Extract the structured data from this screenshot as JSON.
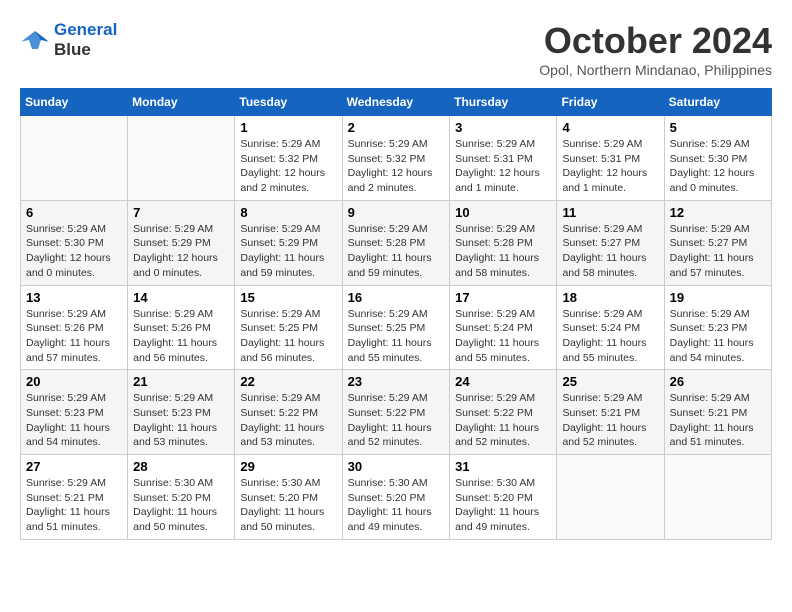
{
  "header": {
    "logo_line1": "General",
    "logo_line2": "Blue",
    "month": "October 2024",
    "location": "Opol, Northern Mindanao, Philippines"
  },
  "weekdays": [
    "Sunday",
    "Monday",
    "Tuesday",
    "Wednesday",
    "Thursday",
    "Friday",
    "Saturday"
  ],
  "weeks": [
    [
      {
        "day": "",
        "info": ""
      },
      {
        "day": "",
        "info": ""
      },
      {
        "day": "1",
        "info": "Sunrise: 5:29 AM\nSunset: 5:32 PM\nDaylight: 12 hours\nand 2 minutes."
      },
      {
        "day": "2",
        "info": "Sunrise: 5:29 AM\nSunset: 5:32 PM\nDaylight: 12 hours\nand 2 minutes."
      },
      {
        "day": "3",
        "info": "Sunrise: 5:29 AM\nSunset: 5:31 PM\nDaylight: 12 hours\nand 1 minute."
      },
      {
        "day": "4",
        "info": "Sunrise: 5:29 AM\nSunset: 5:31 PM\nDaylight: 12 hours\nand 1 minute."
      },
      {
        "day": "5",
        "info": "Sunrise: 5:29 AM\nSunset: 5:30 PM\nDaylight: 12 hours\nand 0 minutes."
      }
    ],
    [
      {
        "day": "6",
        "info": "Sunrise: 5:29 AM\nSunset: 5:30 PM\nDaylight: 12 hours\nand 0 minutes."
      },
      {
        "day": "7",
        "info": "Sunrise: 5:29 AM\nSunset: 5:29 PM\nDaylight: 12 hours\nand 0 minutes."
      },
      {
        "day": "8",
        "info": "Sunrise: 5:29 AM\nSunset: 5:29 PM\nDaylight: 11 hours\nand 59 minutes."
      },
      {
        "day": "9",
        "info": "Sunrise: 5:29 AM\nSunset: 5:28 PM\nDaylight: 11 hours\nand 59 minutes."
      },
      {
        "day": "10",
        "info": "Sunrise: 5:29 AM\nSunset: 5:28 PM\nDaylight: 11 hours\nand 58 minutes."
      },
      {
        "day": "11",
        "info": "Sunrise: 5:29 AM\nSunset: 5:27 PM\nDaylight: 11 hours\nand 58 minutes."
      },
      {
        "day": "12",
        "info": "Sunrise: 5:29 AM\nSunset: 5:27 PM\nDaylight: 11 hours\nand 57 minutes."
      }
    ],
    [
      {
        "day": "13",
        "info": "Sunrise: 5:29 AM\nSunset: 5:26 PM\nDaylight: 11 hours\nand 57 minutes."
      },
      {
        "day": "14",
        "info": "Sunrise: 5:29 AM\nSunset: 5:26 PM\nDaylight: 11 hours\nand 56 minutes."
      },
      {
        "day": "15",
        "info": "Sunrise: 5:29 AM\nSunset: 5:25 PM\nDaylight: 11 hours\nand 56 minutes."
      },
      {
        "day": "16",
        "info": "Sunrise: 5:29 AM\nSunset: 5:25 PM\nDaylight: 11 hours\nand 55 minutes."
      },
      {
        "day": "17",
        "info": "Sunrise: 5:29 AM\nSunset: 5:24 PM\nDaylight: 11 hours\nand 55 minutes."
      },
      {
        "day": "18",
        "info": "Sunrise: 5:29 AM\nSunset: 5:24 PM\nDaylight: 11 hours\nand 55 minutes."
      },
      {
        "day": "19",
        "info": "Sunrise: 5:29 AM\nSunset: 5:23 PM\nDaylight: 11 hours\nand 54 minutes."
      }
    ],
    [
      {
        "day": "20",
        "info": "Sunrise: 5:29 AM\nSunset: 5:23 PM\nDaylight: 11 hours\nand 54 minutes."
      },
      {
        "day": "21",
        "info": "Sunrise: 5:29 AM\nSunset: 5:23 PM\nDaylight: 11 hours\nand 53 minutes."
      },
      {
        "day": "22",
        "info": "Sunrise: 5:29 AM\nSunset: 5:22 PM\nDaylight: 11 hours\nand 53 minutes."
      },
      {
        "day": "23",
        "info": "Sunrise: 5:29 AM\nSunset: 5:22 PM\nDaylight: 11 hours\nand 52 minutes."
      },
      {
        "day": "24",
        "info": "Sunrise: 5:29 AM\nSunset: 5:22 PM\nDaylight: 11 hours\nand 52 minutes."
      },
      {
        "day": "25",
        "info": "Sunrise: 5:29 AM\nSunset: 5:21 PM\nDaylight: 11 hours\nand 52 minutes."
      },
      {
        "day": "26",
        "info": "Sunrise: 5:29 AM\nSunset: 5:21 PM\nDaylight: 11 hours\nand 51 minutes."
      }
    ],
    [
      {
        "day": "27",
        "info": "Sunrise: 5:29 AM\nSunset: 5:21 PM\nDaylight: 11 hours\nand 51 minutes."
      },
      {
        "day": "28",
        "info": "Sunrise: 5:30 AM\nSunset: 5:20 PM\nDaylight: 11 hours\nand 50 minutes."
      },
      {
        "day": "29",
        "info": "Sunrise: 5:30 AM\nSunset: 5:20 PM\nDaylight: 11 hours\nand 50 minutes."
      },
      {
        "day": "30",
        "info": "Sunrise: 5:30 AM\nSunset: 5:20 PM\nDaylight: 11 hours\nand 49 minutes."
      },
      {
        "day": "31",
        "info": "Sunrise: 5:30 AM\nSunset: 5:20 PM\nDaylight: 11 hours\nand 49 minutes."
      },
      {
        "day": "",
        "info": ""
      },
      {
        "day": "",
        "info": ""
      }
    ]
  ]
}
